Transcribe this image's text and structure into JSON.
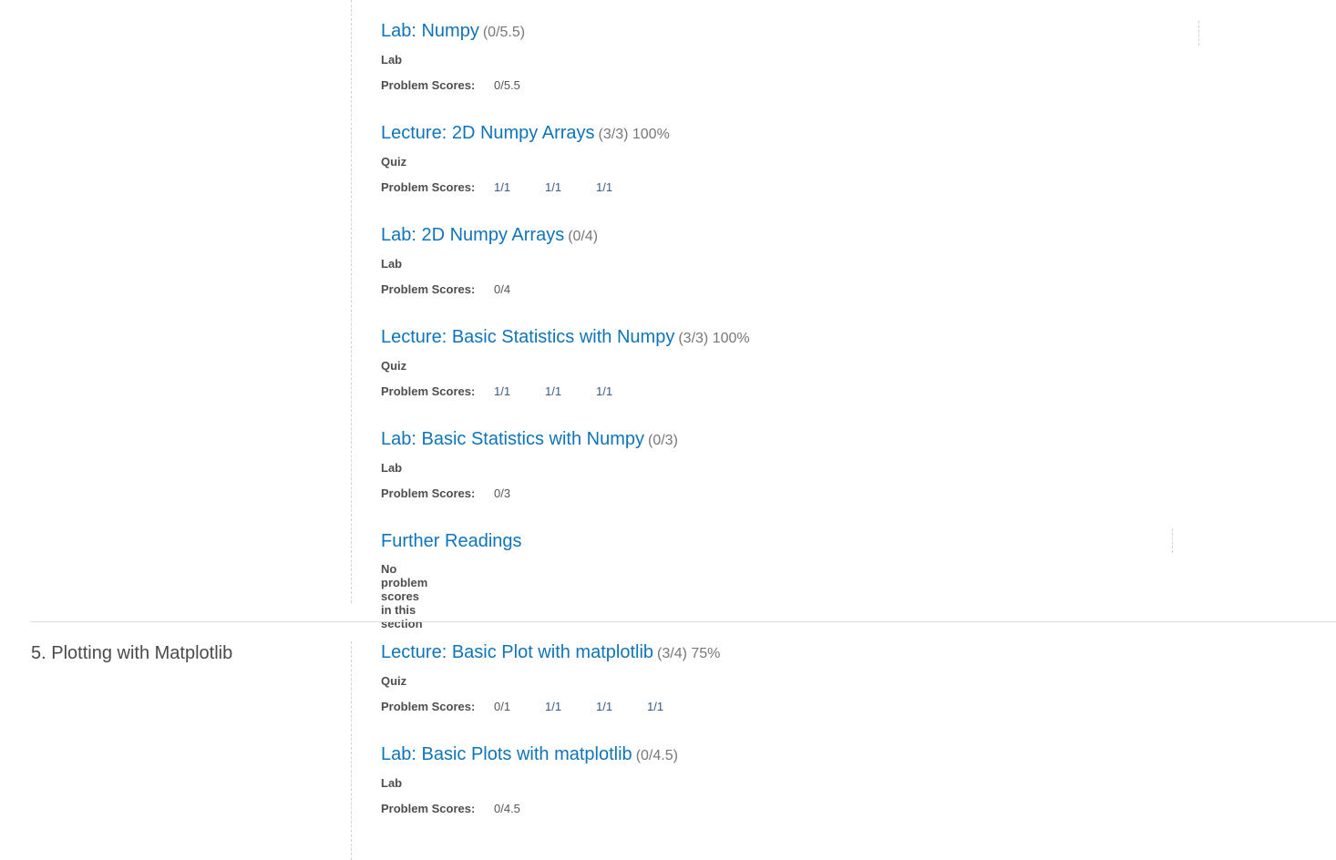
{
  "sections": [
    {
      "title": "",
      "items": [
        {
          "title": "Lab: Numpy",
          "score": "(0/5.5)",
          "type": "Lab",
          "scores_label": "Problem Scores:",
          "scores": [
            "0/5.5"
          ]
        },
        {
          "title": "Lecture: 2D Numpy Arrays",
          "score": "(3/3) 100%",
          "type": "Quiz",
          "scores_label": "Problem Scores:",
          "scores": [
            "1/1",
            "1/1",
            "1/1"
          ]
        },
        {
          "title": "Lab: 2D Numpy Arrays",
          "score": "(0/4)",
          "type": "Lab",
          "scores_label": "Problem Scores:",
          "scores": [
            "0/4"
          ]
        },
        {
          "title": "Lecture: Basic Statistics with Numpy",
          "score": "(3/3) 100%",
          "type": "Quiz",
          "scores_label": "Problem Scores:",
          "scores": [
            "1/1",
            "1/1",
            "1/1"
          ]
        },
        {
          "title": "Lab: Basic Statistics with Numpy",
          "score": "(0/3)",
          "type": "Lab",
          "scores_label": "Problem Scores:",
          "scores": [
            "0/3"
          ]
        },
        {
          "title": "Further Readings",
          "score": "",
          "no_scores": "No problem scores in this section"
        }
      ]
    },
    {
      "title": "5. Plotting with Matplotlib",
      "items": [
        {
          "title": "Lecture: Basic Plot with matplotlib",
          "score": "(3/4) 75%",
          "type": "Quiz",
          "scores_label": "Problem Scores:",
          "scores": [
            "0/1",
            "1/1",
            "1/1",
            "1/1"
          ]
        },
        {
          "title": "Lab: Basic Plots with matplotlib",
          "score": "(0/4.5)",
          "type": "Lab",
          "scores_label": "Problem Scores:",
          "scores": [
            "0/4.5"
          ]
        }
      ]
    }
  ]
}
